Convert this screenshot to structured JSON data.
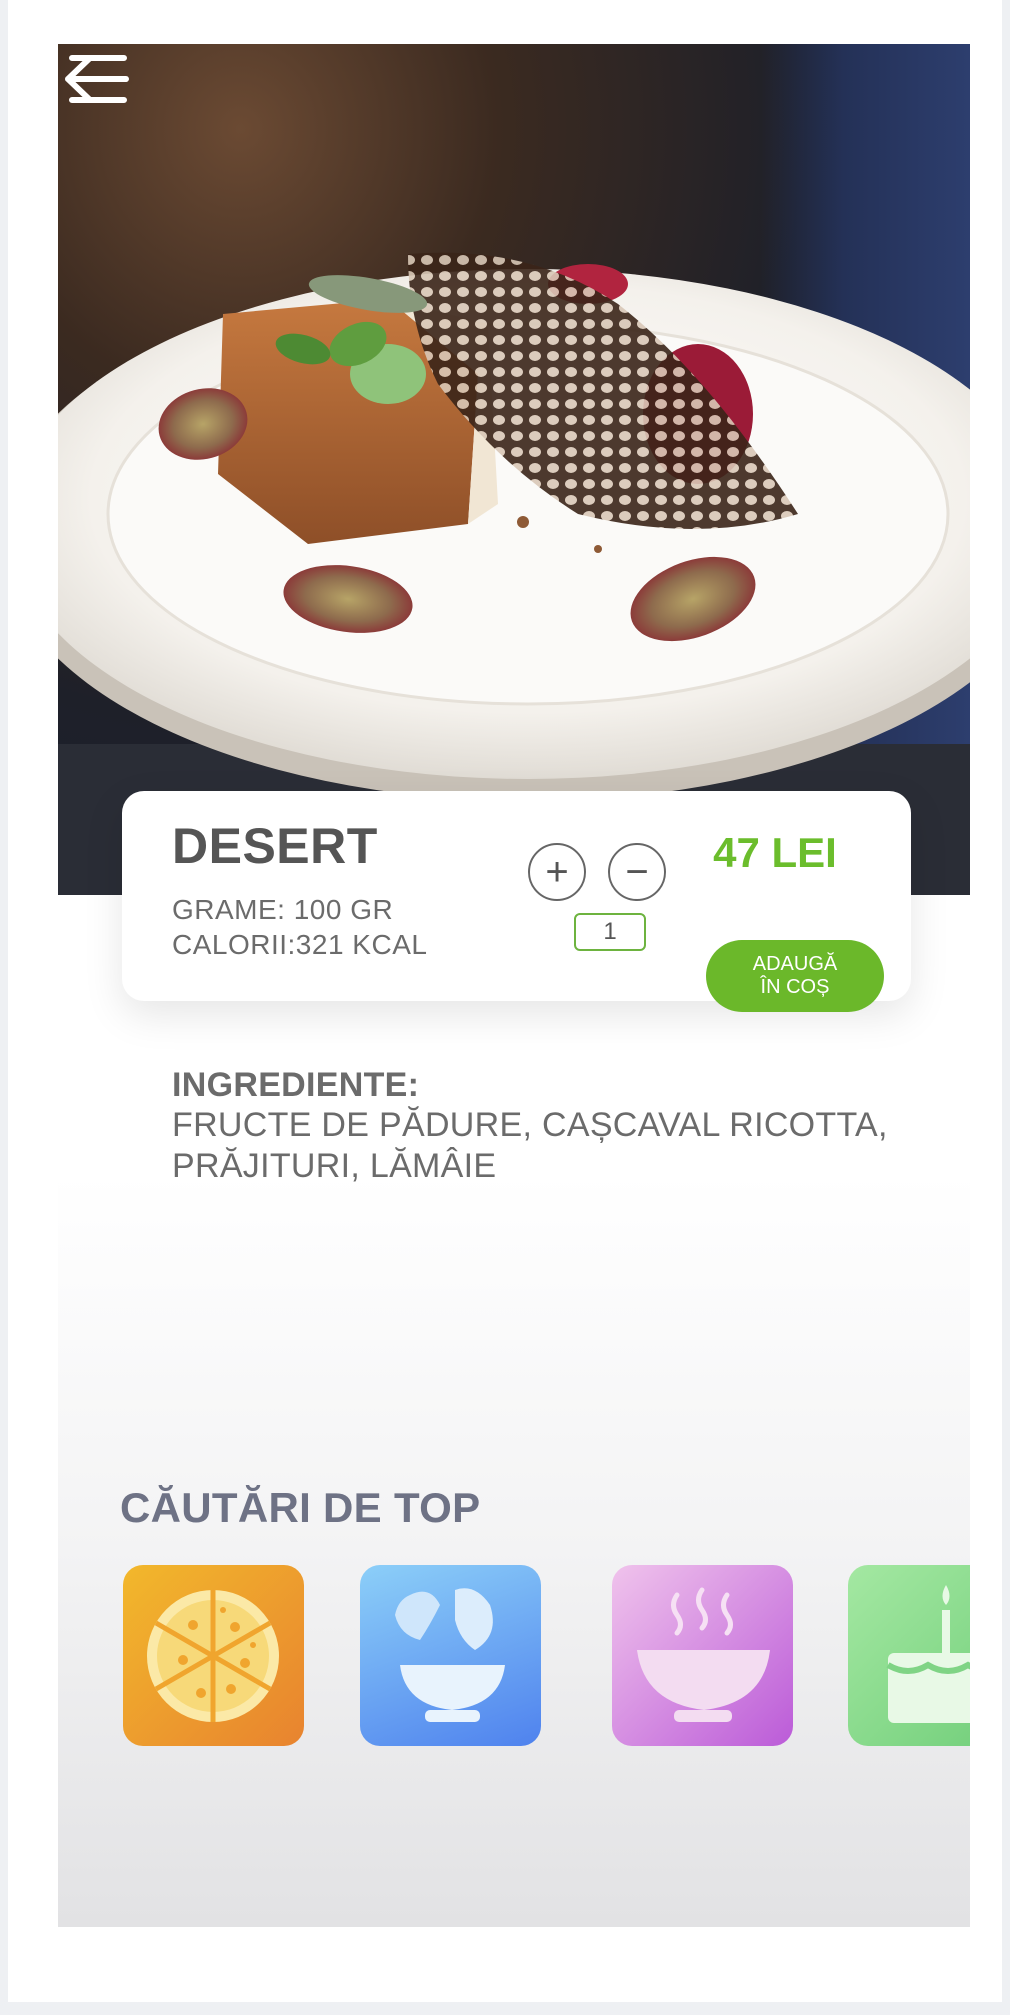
{
  "dish": {
    "name": "DESERT",
    "grams": "GRAME: 100 GR",
    "calories": "CALORII:321 KCAL",
    "price": "47 LEI",
    "quantity": "1",
    "plus_label": "+",
    "minus_label": "−",
    "add_to_cart_line1": "ADAUGĂ",
    "add_to_cart_line2": "ÎN COȘ"
  },
  "ingredients": {
    "title": "INGREDIENTE:",
    "text": "FRUCTE DE PĂDURE, CAȘCAVAL RICOTTA, PRĂJITURI, LĂMÂIE"
  },
  "top_searches": {
    "title": "CĂUTĂRI DE TOP",
    "categories": [
      {
        "icon": "pizza-icon"
      },
      {
        "icon": "salad-icon"
      },
      {
        "icon": "soup-icon"
      },
      {
        "icon": "cake-icon"
      }
    ]
  },
  "header": {
    "back_icon": "arrow-left-icon",
    "menu_icon": "hamburger-menu-icon"
  },
  "colors": {
    "accent_green": "#6bb82a",
    "price_green": "#6bbd2c",
    "text_gray": "#6b6b6b",
    "section_title": "#6e7285"
  }
}
